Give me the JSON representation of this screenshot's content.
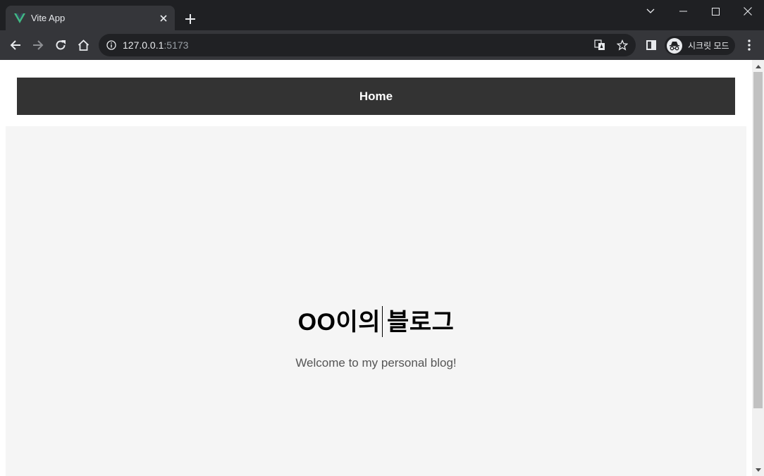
{
  "browser": {
    "tab": {
      "title": "Vite App",
      "favicon": "vue-logo-icon"
    },
    "address": {
      "host": "127.0.0.1",
      "port": ":5173"
    },
    "profile": {
      "label": "시크릿 모드",
      "icon": "incognito-icon"
    }
  },
  "page": {
    "nav": {
      "home_label": "Home"
    },
    "hero": {
      "title_part1": "OO이의",
      "title_part2": "블로그",
      "subtitle": "Welcome to my personal blog!"
    }
  },
  "colors": {
    "navbar_bg": "#333333",
    "hero_bg": "#f5f5f5",
    "vue_green": "#41b883",
    "chrome_dark": "#35363a"
  }
}
